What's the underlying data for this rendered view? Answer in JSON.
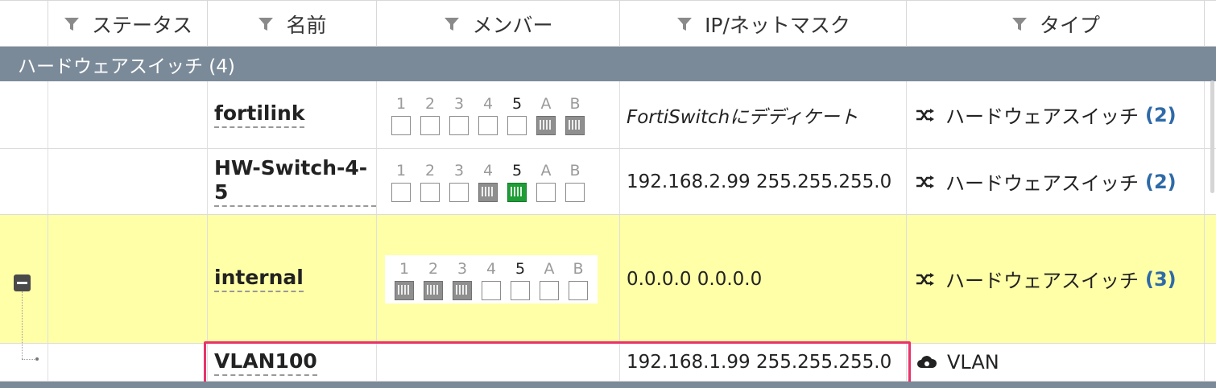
{
  "header": {
    "columns": [
      "ステータス",
      "名前",
      "メンバー",
      "IP/ネットマスク",
      "タイプ"
    ]
  },
  "group": {
    "label": "ハードウェアスイッチ (4)"
  },
  "port_labels": [
    "1",
    "2",
    "3",
    "4",
    "5",
    "A",
    "B"
  ],
  "rows": [
    {
      "name": "fortilink",
      "ip": "FortiSwitchにデディケート",
      "type": "ハードウェアスイッチ",
      "count": "(2)",
      "ports": [
        "empty",
        "empty",
        "empty",
        "empty",
        "empty",
        "gray",
        "gray"
      ],
      "active_label": "5"
    },
    {
      "name": "HW-Switch-4-5",
      "ip": "192.168.2.99 255.255.255.0",
      "type": "ハードウェアスイッチ",
      "count": "(2)",
      "ports": [
        "empty",
        "empty",
        "empty",
        "gray",
        "green",
        "empty",
        "empty"
      ],
      "active_label": "5"
    },
    {
      "name": "internal",
      "ip": "0.0.0.0 0.0.0.0",
      "type": "ハードウェアスイッチ",
      "count": "(3)",
      "ports": [
        "gray",
        "gray",
        "gray",
        "empty",
        "empty",
        "empty",
        "empty"
      ],
      "active_label": "5"
    },
    {
      "name": "VLAN100",
      "ip": "192.168.1.99 255.255.255.0",
      "type": "VLAN"
    }
  ],
  "colors": {
    "group_bar": "#7b8a99",
    "selected_row": "#ffffa8",
    "highlight_box": "#e8336a",
    "count_link": "#2e6aa8"
  },
  "icons": {
    "filter": "funnel-icon",
    "hw_switch": "shuffle-icon",
    "vlan": "cloud-gear-icon",
    "collapse": "minus-square-icon"
  }
}
